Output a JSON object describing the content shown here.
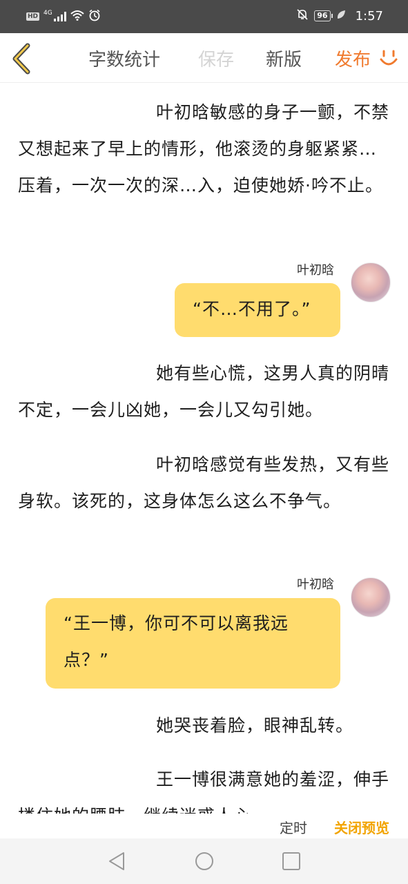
{
  "status_bar": {
    "hd": "HD",
    "network": "4G",
    "battery": "96",
    "time": "1:57"
  },
  "toolbar": {
    "word_count": "字数统计",
    "save": "保存",
    "new_version": "新版",
    "publish": "发布"
  },
  "content": {
    "para1": "叶初晗敏感的身子一颤，不禁又想起来了早上的情形，他滚烫的身躯紧紧…压着，一次一次的深…入，迫使她娇·吟不止。",
    "dialog1_name": "叶初晗",
    "dialog1_text": "“不…不用了。”",
    "para2": "她有些心慌，这男人真的阴晴不定，一会儿凶她，一会儿又勾引她。",
    "para3": "叶初晗感觉有些发热，又有些身软。该死的，这身体怎么这么不争气。",
    "dialog2_name": "叶初晗",
    "dialog2_text": "“王一博，你可不可以离我远点？”",
    "para4": "她哭丧着脸，眼神乱转。",
    "para5": "王一博很满意她的羞涩，伸手搂住她的腰肢，继续迷惑人心"
  },
  "bottom": {
    "timer": "定时",
    "close_preview": "关闭预览"
  }
}
